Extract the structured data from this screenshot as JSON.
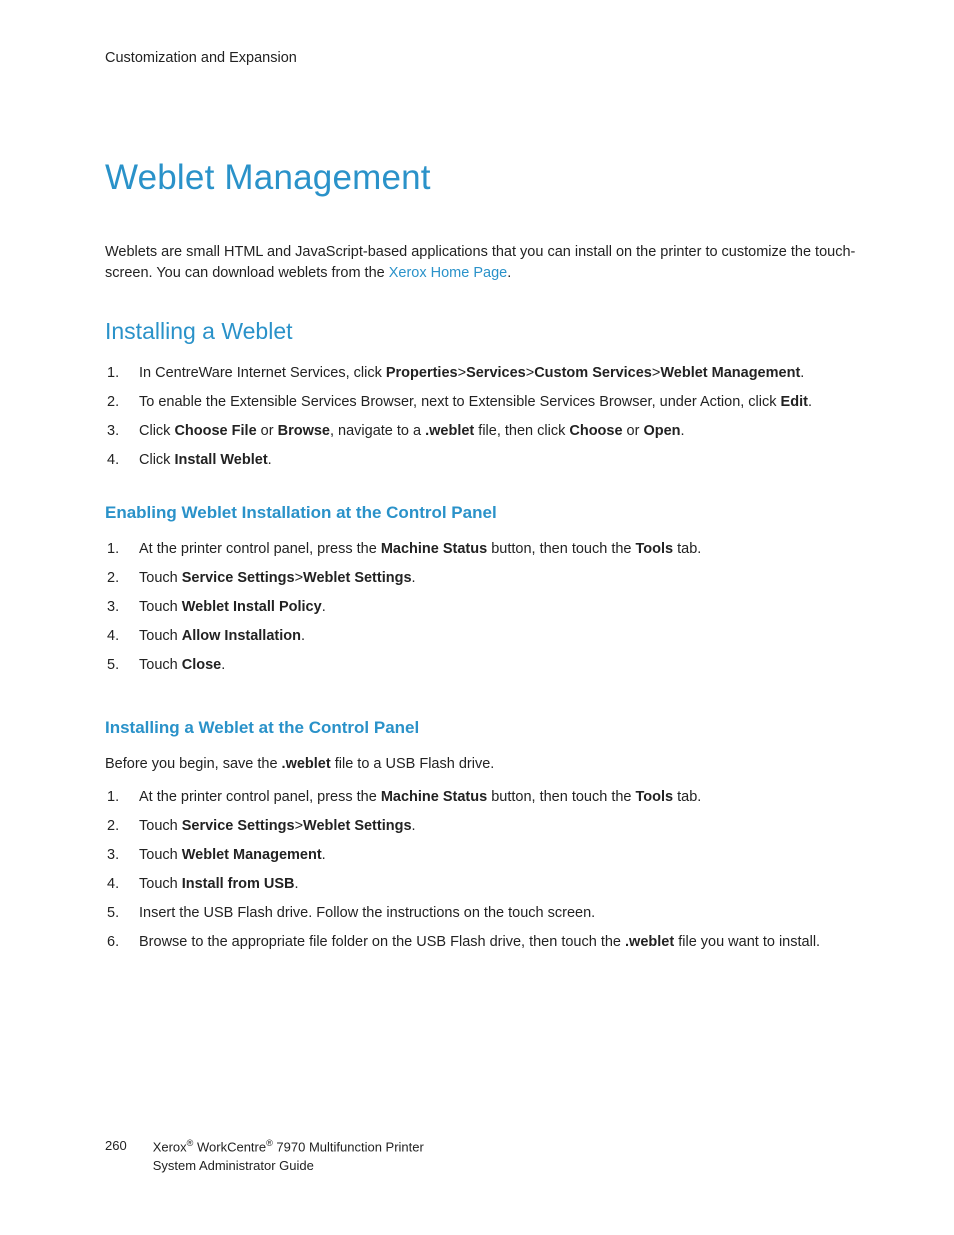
{
  "header": {
    "section_label": "Customization and Expansion"
  },
  "title": "Weblet Management",
  "intro": {
    "text_before_link": "Weblets are small HTML and JavaScript-based applications that you can install on the printer to customize the touch-screen. You can download weblets from the ",
    "link_text": "Xerox Home Page",
    "text_after_link": "."
  },
  "section_install": {
    "heading": "Installing a Weblet",
    "steps": [
      {
        "pre": "In CentreWare Internet Services, click ",
        "b1": "Properties",
        "mid1": ">",
        "b2": "Services",
        "mid2": ">",
        "b3": "Custom Services",
        "mid3": ">",
        "b4": "Weblet Management",
        "post": "."
      },
      {
        "pre": "To enable the Extensible Services Browser, next to Extensible Services Browser, under Action, click ",
        "b1": "Edit",
        "post": "."
      },
      {
        "pre": "Click ",
        "b1": "Choose File",
        "mid1": " or ",
        "b2": "Browse",
        "mid2": ", navigate to a ",
        "b3": ".weblet",
        "mid3": " file, then click ",
        "b4": "Choose",
        "mid4": " or ",
        "b5": "Open",
        "post": "."
      },
      {
        "pre": "Click ",
        "b1": "Install Weblet",
        "post": "."
      }
    ]
  },
  "section_enable": {
    "heading": "Enabling Weblet Installation at the Control Panel",
    "steps": [
      {
        "pre": "At the printer control panel, press the ",
        "b1": "Machine Status",
        "mid1": " button, then touch the ",
        "b2": "Tools",
        "post": " tab."
      },
      {
        "pre": "Touch ",
        "b1": "Service Settings",
        "mid1": ">",
        "b2": "Weblet Settings",
        "post": "."
      },
      {
        "pre": "Touch ",
        "b1": "Weblet Install Policy",
        "post": "."
      },
      {
        "pre": "Touch ",
        "b1": "Allow Installation",
        "post": "."
      },
      {
        "pre": "Touch ",
        "b1": "Close",
        "post": "."
      }
    ]
  },
  "section_install_cp": {
    "heading": "Installing a Weblet at the Control Panel",
    "before": {
      "pre": "Before you begin, save the ",
      "b1": ".weblet",
      "post": " file to a USB Flash drive."
    },
    "steps": [
      {
        "pre": "At the printer control panel, press the ",
        "b1": "Machine Status",
        "mid1": " button, then touch the ",
        "b2": "Tools",
        "post": " tab."
      },
      {
        "pre": "Touch ",
        "b1": "Service Settings",
        "mid1": ">",
        "b2": "Weblet Settings",
        "post": "."
      },
      {
        "pre": "Touch ",
        "b1": "Weblet Management",
        "post": "."
      },
      {
        "pre": "Touch ",
        "b1": "Install from USB",
        "post": "."
      },
      {
        "pre": "Insert the USB Flash drive. Follow the instructions on the touch screen.",
        "post": ""
      },
      {
        "pre": "Browse to the appropriate file folder on the USB Flash drive, then touch the ",
        "b1": ".weblet",
        "post": " file you want to install."
      }
    ]
  },
  "footer": {
    "page_number": "260",
    "brand1": "Xerox",
    "reg1": "®",
    "brand2": " WorkCentre",
    "reg2": "®",
    "model": " 7970 Multifunction Printer",
    "line2": "System Administrator Guide"
  }
}
